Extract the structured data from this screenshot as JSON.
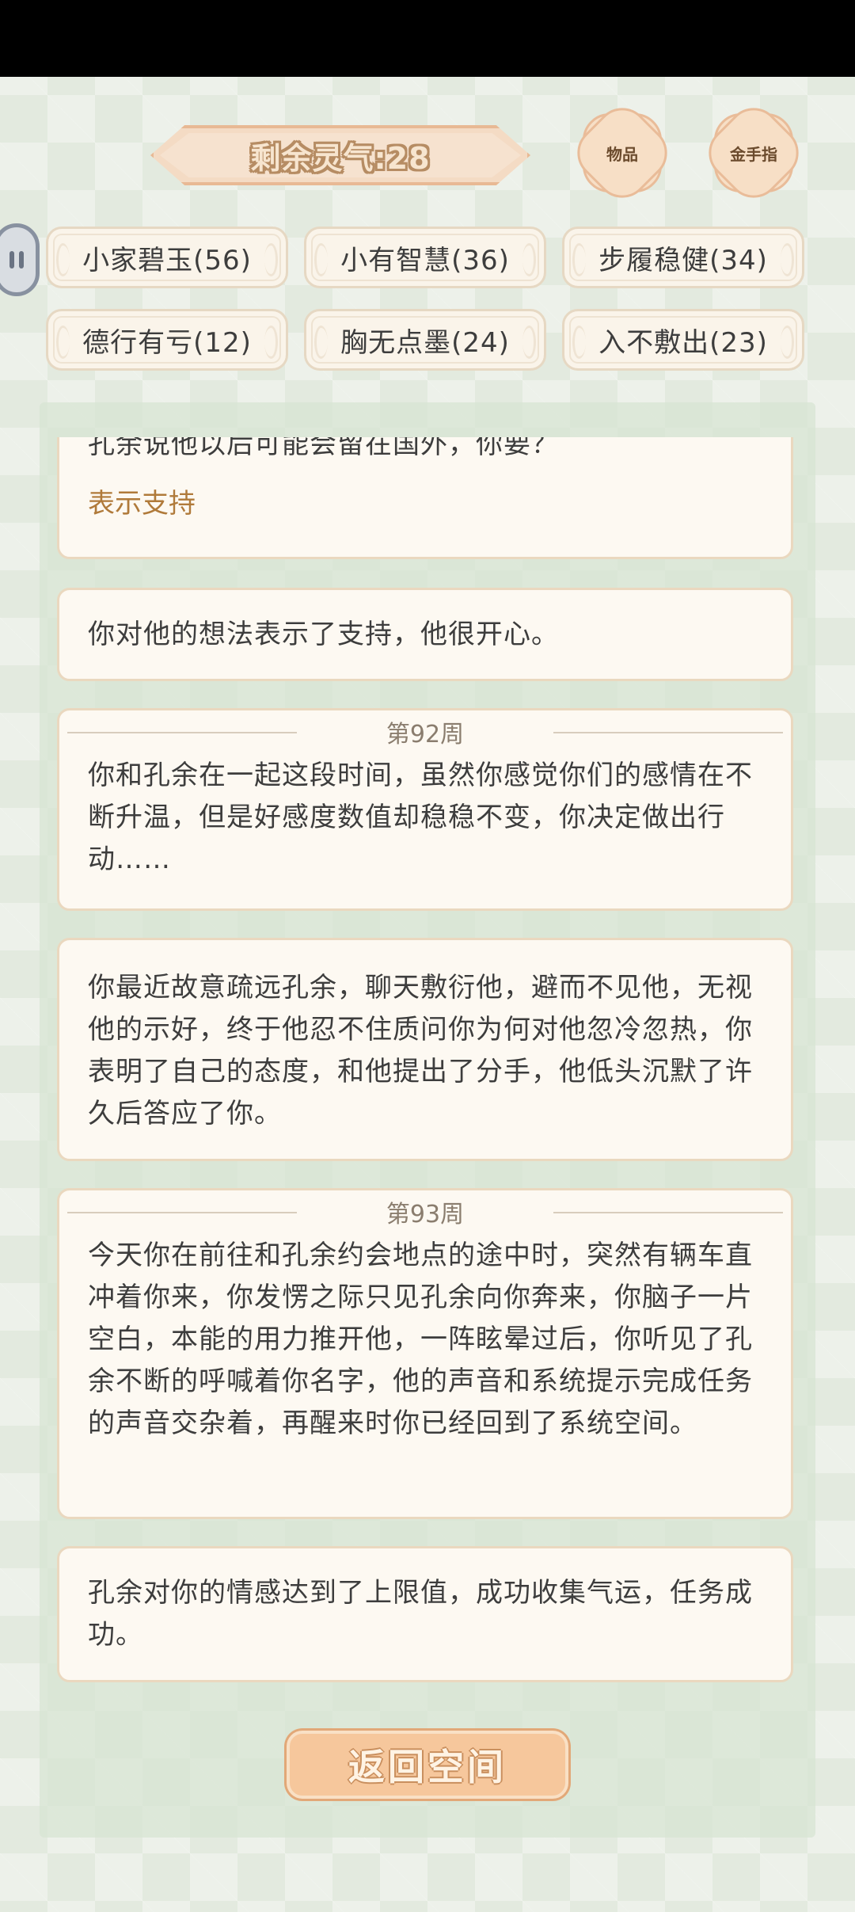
{
  "header": {
    "spirit_label": "剩余灵气:28",
    "items_button": "物品",
    "cheat_button": "金手指"
  },
  "traits": [
    {
      "label": "小家碧玉(56)"
    },
    {
      "label": "小有智慧(36)"
    },
    {
      "label": "步履稳健(34)"
    },
    {
      "label": "德行有亏(12)"
    },
    {
      "label": "胸无点墨(24)"
    },
    {
      "label": "入不敷出(23)"
    }
  ],
  "log": {
    "cards": [
      {
        "text": "孔余说他以后可能会留在国外，你要？",
        "choice": "表示支持"
      },
      {
        "text": "你对他的想法表示了支持，他很开心。"
      },
      {
        "week": "第92周",
        "text": "你和孔余在一起这段时间，虽然你感觉你们的感情在不断升温，但是好感度数值却稳稳不变，你决定做出行动……"
      },
      {
        "text": "你最近故意疏远孔余，聊天敷衍他，避而不见他，无视他的示好，终于他忍不住质问你为何对他忽冷忽热，你表明了自己的态度，和他提出了分手，他低头沉默了许久后答应了你。"
      },
      {
        "week": "第93周",
        "text": "今天你在前往和孔余约会地点的途中时，突然有辆车直冲着你来，你发愣之际只见孔余向你奔来，你脑子一片空白，本能的用力推开他，一阵眩晕过后，你听见了孔余不断的呼喊着你名字，他的声音和系统提示完成任务的声音交杂着，再醒来时你已经回到了系统空间。"
      },
      {
        "text": "孔余对你的情感达到了上限值，成功收集气运，任务成功。"
      }
    ]
  },
  "footer": {
    "return_button": "返回空间"
  }
}
